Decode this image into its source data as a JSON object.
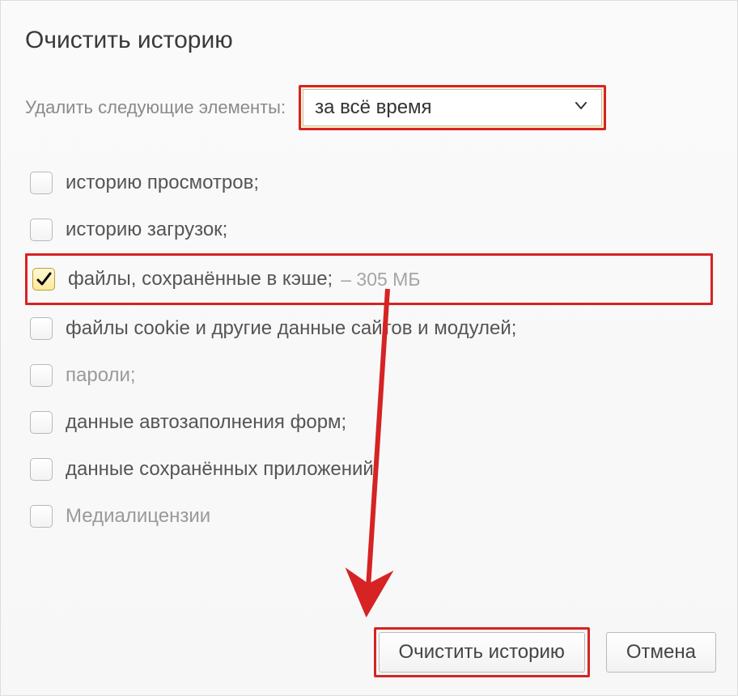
{
  "title": "Очистить историю",
  "time": {
    "label": "Удалить следующие элементы:",
    "selected": "за всё время"
  },
  "options": [
    {
      "label": "историю просмотров;",
      "checked": false,
      "dim": false,
      "highlight": false,
      "extra": ""
    },
    {
      "label": "историю загрузок;",
      "checked": false,
      "dim": false,
      "highlight": false,
      "extra": ""
    },
    {
      "label": "файлы, сохранённые в кэше;",
      "checked": true,
      "dim": false,
      "highlight": true,
      "extra": "–  305 МБ"
    },
    {
      "label": "файлы cookie и другие данные сайтов и модулей;",
      "checked": false,
      "dim": false,
      "highlight": false,
      "extra": ""
    },
    {
      "label": "пароли;",
      "checked": false,
      "dim": true,
      "highlight": false,
      "extra": ""
    },
    {
      "label": "данные автозаполнения форм;",
      "checked": false,
      "dim": false,
      "highlight": false,
      "extra": ""
    },
    {
      "label": "данные сохранённых приложений.",
      "checked": false,
      "dim": false,
      "highlight": false,
      "extra": ""
    },
    {
      "label": "Медиалицензии",
      "checked": false,
      "dim": true,
      "highlight": false,
      "extra": ""
    }
  ],
  "buttons": {
    "clear": "Очистить историю",
    "cancel": "Отмена"
  }
}
